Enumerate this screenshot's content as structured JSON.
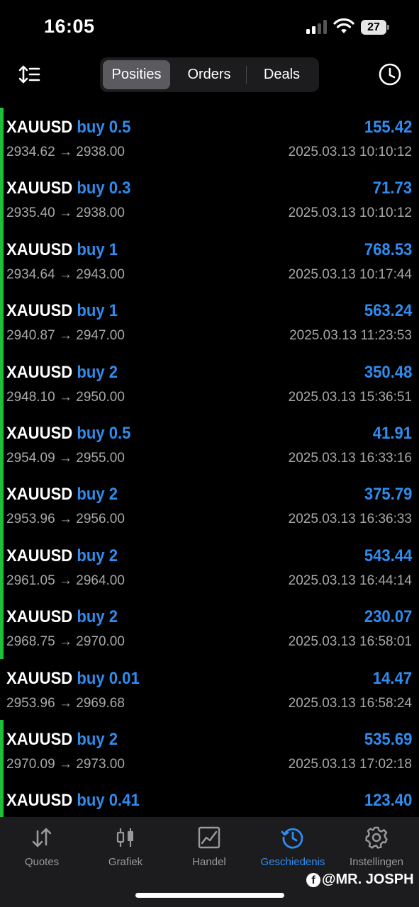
{
  "status_bar": {
    "time": "16:05",
    "battery": "27"
  },
  "header": {
    "tabs": [
      {
        "label": "Posities",
        "active": true
      },
      {
        "label": "Orders",
        "active": false
      },
      {
        "label": "Deals",
        "active": false
      }
    ],
    "left_icon": "sort-icon",
    "right_icon": "history-clock-icon"
  },
  "positions": [
    {
      "symbol": "XAUUSD",
      "direction": "buy 0.5",
      "profit": "155.42",
      "open_price": "2934.62",
      "current_price": "2938.00",
      "time": "2025.03.13 10:10:12",
      "marker": true
    },
    {
      "symbol": "XAUUSD",
      "direction": "buy 0.3",
      "profit": "71.73",
      "open_price": "2935.40",
      "current_price": "2938.00",
      "time": "2025.03.13 10:10:12",
      "marker": true
    },
    {
      "symbol": "XAUUSD",
      "direction": "buy 1",
      "profit": "768.53",
      "open_price": "2934.64",
      "current_price": "2943.00",
      "time": "2025.03.13 10:17:44",
      "marker": true
    },
    {
      "symbol": "XAUUSD",
      "direction": "buy 1",
      "profit": "563.24",
      "open_price": "2940.87",
      "current_price": "2947.00",
      "time": "2025.03.13 11:23:53",
      "marker": true
    },
    {
      "symbol": "XAUUSD",
      "direction": "buy 2",
      "profit": "350.48",
      "open_price": "2948.10",
      "current_price": "2950.00",
      "time": "2025.03.13 15:36:51",
      "marker": true
    },
    {
      "symbol": "XAUUSD",
      "direction": "buy 0.5",
      "profit": "41.91",
      "open_price": "2954.09",
      "current_price": "2955.00",
      "time": "2025.03.13 16:33:16",
      "marker": true
    },
    {
      "symbol": "XAUUSD",
      "direction": "buy 2",
      "profit": "375.79",
      "open_price": "2953.96",
      "current_price": "2956.00",
      "time": "2025.03.13 16:36:33",
      "marker": true
    },
    {
      "symbol": "XAUUSD",
      "direction": "buy 2",
      "profit": "543.44",
      "open_price": "2961.05",
      "current_price": "2964.00",
      "time": "2025.03.13 16:44:14",
      "marker": true
    },
    {
      "symbol": "XAUUSD",
      "direction": "buy 2",
      "profit": "230.07",
      "open_price": "2968.75",
      "current_price": "2970.00",
      "time": "2025.03.13 16:58:01",
      "marker": true
    },
    {
      "symbol": "XAUUSD",
      "direction": "buy 0.01",
      "profit": "14.47",
      "open_price": "2953.96",
      "current_price": "2969.68",
      "time": "2025.03.13 16:58:24",
      "marker": false
    },
    {
      "symbol": "XAUUSD",
      "direction": "buy 2",
      "profit": "535.69",
      "open_price": "2970.09",
      "current_price": "2973.00",
      "time": "2025.03.13 17:02:18",
      "marker": true
    },
    {
      "symbol": "XAUUSD",
      "direction": "buy 0.41",
      "profit": "123.40",
      "open_price": "",
      "current_price": "",
      "time": "",
      "marker": true
    }
  ],
  "tabbar": [
    {
      "label": "Quotes",
      "icon": "quotes-arrows-icon",
      "active": false
    },
    {
      "label": "Grafiek",
      "icon": "candlestick-chart-icon",
      "active": false
    },
    {
      "label": "Handel",
      "icon": "trade-chart-icon",
      "active": false
    },
    {
      "label": "Geschiedenis",
      "icon": "history-clock-icon",
      "active": true
    },
    {
      "label": "Instellingen",
      "icon": "gear-icon",
      "active": false
    }
  ],
  "watermark": "@MR. JOSPH",
  "colors": {
    "accent": "#2f8cf0",
    "marker": "#1fbf3b",
    "muted": "#a8a8a8"
  }
}
